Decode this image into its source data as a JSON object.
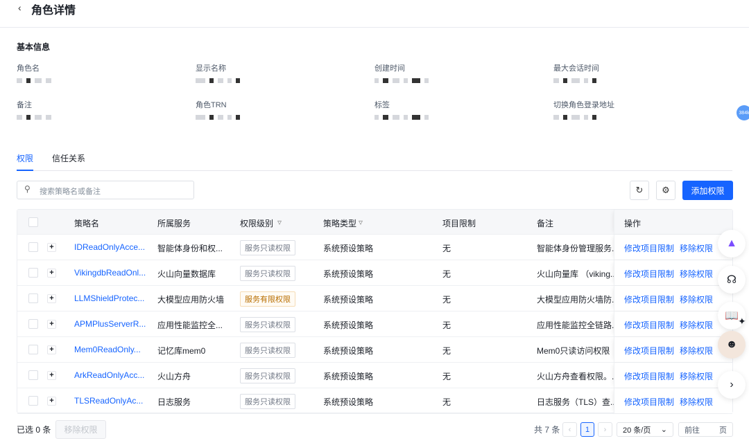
{
  "header": {
    "back_icon": "chevron-left-icon",
    "title": "角色详情"
  },
  "basic": {
    "section_title": "基本信息",
    "fields": [
      {
        "label": "角色名"
      },
      {
        "label": "显示名称"
      },
      {
        "label": "创建时间"
      },
      {
        "label": "最大会话时间"
      },
      {
        "label": "备注"
      },
      {
        "label": "角色TRN"
      },
      {
        "label": "标签"
      },
      {
        "label": "切换角色登录地址"
      }
    ]
  },
  "side_badge": "384k",
  "tabs": [
    {
      "label": "权限",
      "active": true
    },
    {
      "label": "信任关系",
      "active": false
    }
  ],
  "toolbar": {
    "search_placeholder": "搜索策略名或备注",
    "add_label": "添加权限"
  },
  "table": {
    "columns": [
      "策略名",
      "所属服务",
      "权限级别",
      "策略类型",
      "项目限制",
      "备注",
      "操作"
    ],
    "rows": [
      {
        "name": "IDReadOnlyAcce...",
        "service": "智能体身份和权...",
        "level": "服务只读权限",
        "level_type": "normal",
        "type": "系统预设策略",
        "project": "无",
        "note": "智能体身份管理服务..."
      },
      {
        "name": "VikingdbReadOnl...",
        "service": "火山向量数据库",
        "level": "服务只读权限",
        "level_type": "normal",
        "type": "系统预设策略",
        "project": "无",
        "note": "火山向量库 （viking..."
      },
      {
        "name": "LLMShieldProtec...",
        "service": "大模型应用防火墙",
        "level": "服务有限权限",
        "level_type": "warn",
        "type": "系统预设策略",
        "project": "无",
        "note": "大模型应用防火墙防..."
      },
      {
        "name": "APMPlusServerR...",
        "service": "应用性能监控全...",
        "level": "服务只读权限",
        "level_type": "normal",
        "type": "系统预设策略",
        "project": "无",
        "note": "应用性能监控全链路..."
      },
      {
        "name": "Mem0ReadOnly...",
        "service": "记忆库mem0",
        "level": "服务只读权限",
        "level_type": "normal",
        "type": "系统预设策略",
        "project": "无",
        "note": "Mem0只读访问权限"
      },
      {
        "name": "ArkReadOnlyAcc...",
        "service": "火山方舟",
        "level": "服务只读权限",
        "level_type": "normal",
        "type": "系统预设策略",
        "project": "无",
        "note": "火山方舟查看权限。..."
      },
      {
        "name": "TLSReadOnlyAc...",
        "service": "日志服务",
        "level": "服务只读权限",
        "level_type": "normal",
        "type": "系统预设策略",
        "project": "无",
        "note": "日志服务（TLS）查..."
      }
    ],
    "action_edit": "修改项目限制",
    "action_remove": "移除权限"
  },
  "footer": {
    "selected": "已选 0 条",
    "remove_label": "移除权限",
    "total": "共 7 条",
    "current_page": "1",
    "page_size": "20 条/页",
    "goto_prefix": "前往",
    "goto_suffix": "页"
  }
}
